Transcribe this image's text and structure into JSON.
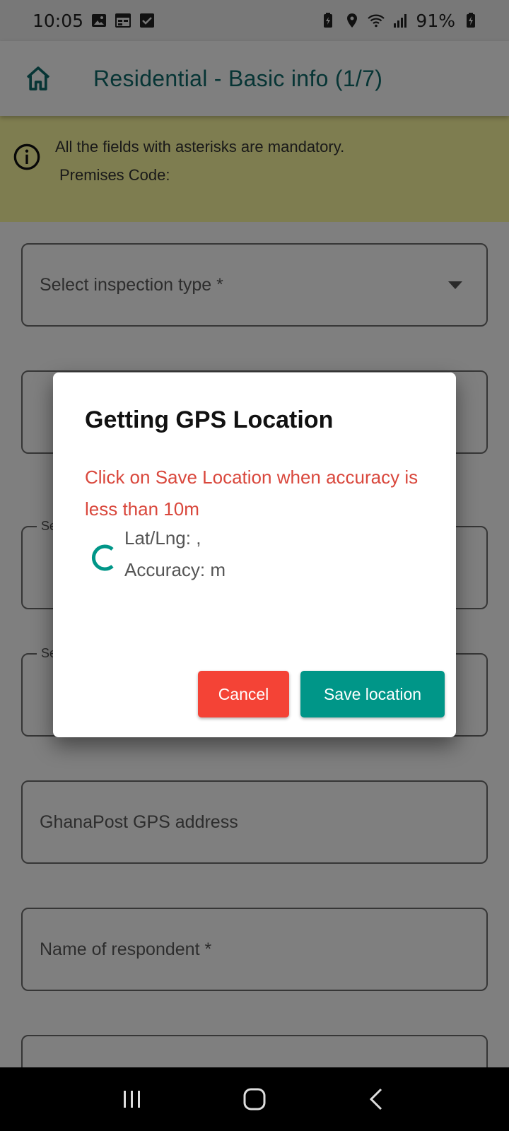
{
  "status_bar": {
    "time": "10:05",
    "battery": "91%",
    "left_icons": [
      "image-icon",
      "calendar-icon",
      "checkbox-icon"
    ],
    "right_icons": [
      "battery-saver-icon",
      "location-icon",
      "wifi-icon",
      "signal-icon",
      "battery-charging-icon"
    ]
  },
  "app_bar": {
    "title": "Residential - Basic info (1/7)",
    "home_icon": "home-icon",
    "accent_color": "#0e6a6a"
  },
  "info_banner": {
    "line1": "All the fields with asterisks are mandatory.",
    "line2": "Premises Code:",
    "icon": "info-icon",
    "background": "#fdfaa0"
  },
  "form": {
    "inspection_type_placeholder": "Select inspection type *",
    "legend_1": "Se",
    "legend_2": "Se",
    "ghanapost_placeholder": "GhanaPost GPS address",
    "respondent_placeholder": "Name of respondent *"
  },
  "dialog": {
    "title": "Getting GPS Location",
    "warning": "Click on Save Location when accuracy is less than 10m",
    "latlng": "Lat/Lng:  ,",
    "accuracy": "Accuracy:  m",
    "cancel_label": "Cancel",
    "save_label": "Save location",
    "cancel_color": "#f44336",
    "save_color": "#009688",
    "warning_color": "#d9473c"
  },
  "nav_bar": {
    "icons": [
      "recent-apps-icon",
      "home-nav-icon",
      "back-icon"
    ]
  }
}
